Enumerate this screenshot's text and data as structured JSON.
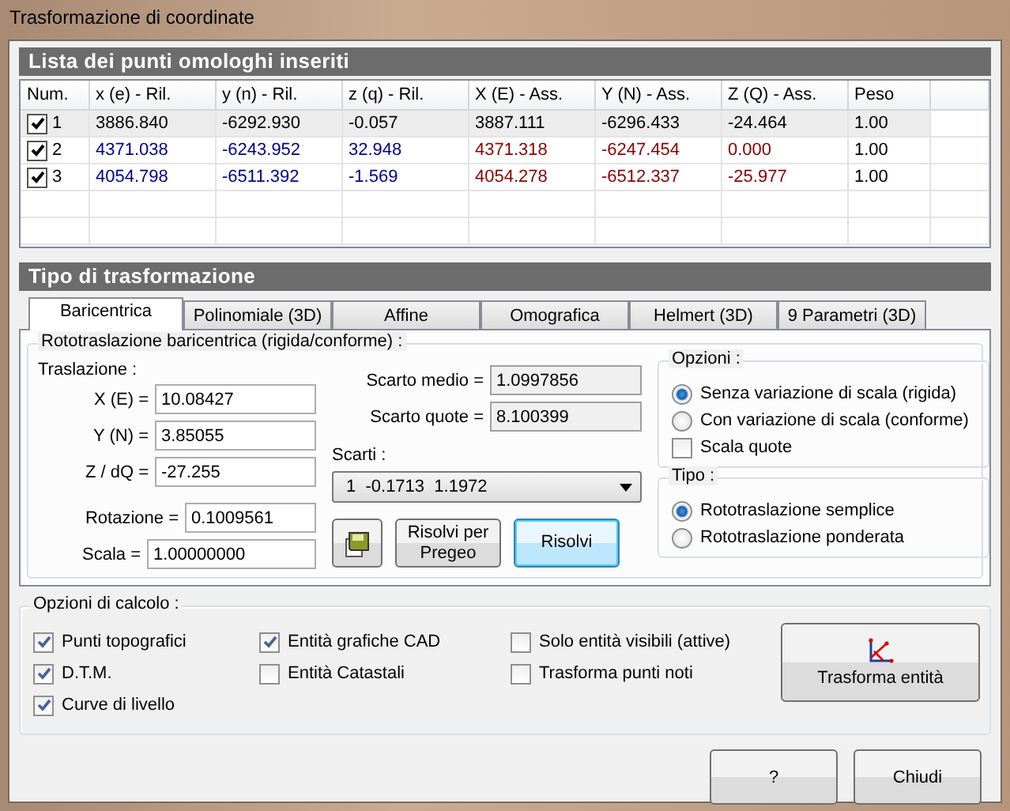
{
  "window": {
    "title": "Trasformazione di coordinate"
  },
  "points": {
    "title": "Lista dei punti omologhi inseriti",
    "columns": [
      {
        "label": "Num.",
        "kind": "num"
      },
      {
        "label": "x (e) - Ril.",
        "kind": "ril"
      },
      {
        "label": "y (n) - Ril.",
        "kind": "ril"
      },
      {
        "label": "z (q) - Ril.",
        "kind": "ril"
      },
      {
        "label": "X (E) - Ass.",
        "kind": "ass"
      },
      {
        "label": "Y (N) - Ass.",
        "kind": "ass"
      },
      {
        "label": "Z (Q) - Ass.",
        "kind": "ass"
      },
      {
        "label": "Peso",
        "kind": "weight"
      }
    ],
    "rows": [
      {
        "checked": true,
        "selected": true,
        "cells": [
          "1",
          "3886.840",
          "-6292.930",
          "-0.057",
          "3887.111",
          "-6296.433",
          "-24.464",
          "1.00"
        ]
      },
      {
        "checked": true,
        "selected": false,
        "cells": [
          "2",
          "4371.038",
          "-6243.952",
          "32.948",
          "4371.318",
          "-6247.454",
          "0.000",
          "1.00"
        ]
      },
      {
        "checked": true,
        "selected": false,
        "cells": [
          "3",
          "4054.798",
          "-6511.392",
          "-1.569",
          "4054.278",
          "-6512.337",
          "-25.977",
          "1.00"
        ]
      }
    ]
  },
  "transformation": {
    "title": "Tipo di trasformazione",
    "tabs": [
      {
        "label": "Baricentrica",
        "selected": true
      },
      {
        "label": "Polinomiale (3D)",
        "selected": false
      },
      {
        "label": "Affine",
        "selected": false
      },
      {
        "label": "Omografica",
        "selected": false
      },
      {
        "label": "Helmert (3D)",
        "selected": false
      },
      {
        "label": "9 Parametri (3D)",
        "selected": false
      }
    ],
    "group_title": "Rototraslazione baricentrica (rigida/conforme) :",
    "translation_label": "Traslazione :",
    "translation_fields": [
      {
        "label": "X (E) =",
        "value": "10.08427"
      },
      {
        "label": "Y (N) =",
        "value": "3.85055"
      },
      {
        "label": "Z / dQ =",
        "value": "-27.255"
      }
    ],
    "rotation": {
      "label": "Rotazione =",
      "value": "0.1009561"
    },
    "scale": {
      "label": "Scala =",
      "value": "1.00000000"
    },
    "residuals": [
      {
        "label": "Scarto medio =",
        "value": "1.0997856"
      },
      {
        "label": "Scarto quote =",
        "value": "8.100399"
      }
    ],
    "scarti": {
      "label": "Scarti :",
      "value": "1  -0.1713  1.1972"
    },
    "buttons": [
      {
        "kind": "icon",
        "default": false
      },
      {
        "kind": "text",
        "label": "Risolvi per Pregeo",
        "default": false
      },
      {
        "kind": "text",
        "label": "Risolvi",
        "default": true
      }
    ],
    "options": {
      "title": "Opzioni :",
      "items": [
        {
          "kind": "radio",
          "label": "Senza variazione di scala (rigida)",
          "selected": true
        },
        {
          "kind": "radio",
          "label": "Con variazione di scala (conforme)",
          "selected": false
        },
        {
          "kind": "checkbox",
          "label": "Scala quote",
          "checked": false
        }
      ]
    },
    "type": {
      "title": "Tipo :",
      "items": [
        {
          "kind": "radio",
          "label": "Rototraslazione semplice",
          "selected": true
        },
        {
          "kind": "radio",
          "label": "Rototraslazione ponderata",
          "selected": false
        }
      ]
    }
  },
  "calc_options": {
    "title": "Opzioni di calcolo :",
    "columns": [
      [
        {
          "label": "Punti topografici",
          "checked": true
        },
        {
          "label": "D.T.M.",
          "checked": true
        },
        {
          "label": "Curve di livello",
          "checked": true
        }
      ],
      [
        {
          "label": "Entità grafiche CAD",
          "checked": true
        },
        {
          "label": "Entità Catastali",
          "checked": false
        }
      ],
      [
        {
          "label": "Solo entità visibili (attive)",
          "checked": false
        },
        {
          "label": "Trasforma punti noti",
          "checked": false
        }
      ]
    ],
    "transform_button": "Trasforma entità"
  },
  "footer_buttons": [
    "?",
    "Chiudi"
  ]
}
